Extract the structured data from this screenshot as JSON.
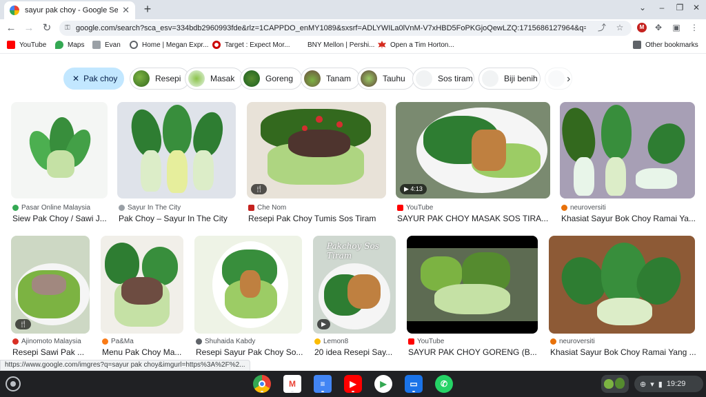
{
  "tab": {
    "title": "sayur pak choy - Google Search"
  },
  "address": {
    "url": "google.com/search?sca_esv=334bdb2960993fde&rlz=1CAPPDO_enMY1089&sxsrf=ADLYWILa0lVnM-V7xHBD5FoPKGjoQewLZQ:1715686127964&q=s..."
  },
  "bookmarks": [
    {
      "label": "YouTube",
      "color": "#ff0000"
    },
    {
      "label": "Maps",
      "color": "#34a853"
    },
    {
      "label": "Evan",
      "color": "#9aa0a6"
    },
    {
      "label": "Home | Megan Expr...",
      "color": "#5f6368"
    },
    {
      "label": "Target : Expect Mor...",
      "color": "#cc0000"
    },
    {
      "label": "BNY Mellon | Pershi...",
      "color": "#ffffff"
    },
    {
      "label": "Open a Tim Horton...",
      "color": "#d52b1e"
    },
    {
      "label": "Other bookmarks",
      "color": "#5f6368"
    }
  ],
  "chips": [
    {
      "label": "Pak choy",
      "active": true
    },
    {
      "label": "Resepi"
    },
    {
      "label": "Masak"
    },
    {
      "label": "Goreng"
    },
    {
      "label": "Tanam"
    },
    {
      "label": "Tauhu"
    },
    {
      "label": "Sos tiram"
    },
    {
      "label": "Biji benih"
    }
  ],
  "results_row1": [
    {
      "source": "Pasar Online Malaysia",
      "caption": "Siew Pak Choy / Sawi J...",
      "icon_color": "#34a853"
    },
    {
      "source": "Sayur In The City",
      "caption": "Pak Choy – Sayur In The City",
      "icon_color": "#9aa0a6"
    },
    {
      "source": "Che Nom",
      "caption": "Resepi Pak Choy Tumis Sos Tiram",
      "icon_color": "#c5221f"
    },
    {
      "source": "YouTube",
      "caption": "SAYUR PAK CHOY MASAK SOS TIRA...",
      "icon_color": "#ff0000",
      "badge": "▶ 4:13"
    },
    {
      "source": "neuroversiti",
      "caption": "Khasiat Sayur Bok Choy Ramai Ya...",
      "icon_color": "#e8710a"
    }
  ],
  "results_row2": [
    {
      "source": "Ajinomoto Malaysia",
      "caption": "Resepi Sawi Pak ...",
      "icon_color": "#d93025"
    },
    {
      "source": "Pa&Ma",
      "caption": "Menu Pak Choy Ma...",
      "icon_color": "#fa7b17"
    },
    {
      "source": "Shuhaida Kabdy",
      "caption": "Resepi Sayur Pak Choy So...",
      "icon_color": "#5f6368"
    },
    {
      "source": "Lemon8",
      "caption": "20 idea Resepi Say...",
      "icon_color": "#fbbc04"
    },
    {
      "source": "YouTube",
      "caption": "SAYUR PAK CHOY GORENG (B...",
      "icon_color": "#ff0000"
    },
    {
      "source": "neuroversiti",
      "caption": "Khasiat Sayur Bok Choy Ramai Yang ...",
      "icon_color": "#e8710a"
    }
  ],
  "image_overlay_text": "Pakchoy Sos Tiram",
  "status_url": "https://www.google.com/imgres?q=sayur pak choy&imgurl=https%3A%2F%2...",
  "shelf": {
    "apps": [
      {
        "name": "chrome-app",
        "color": "#4285f4"
      },
      {
        "name": "gmail-app",
        "color": "#ffffff"
      },
      {
        "name": "docs-app",
        "color": "#4285f4"
      },
      {
        "name": "youtube-app",
        "color": "#ff0000"
      },
      {
        "name": "play-store-app",
        "color": "#ffffff"
      },
      {
        "name": "files-app",
        "color": "#1a73e8"
      },
      {
        "name": "whatsapp-app",
        "color": "#25d366"
      }
    ],
    "time": "19:29"
  }
}
